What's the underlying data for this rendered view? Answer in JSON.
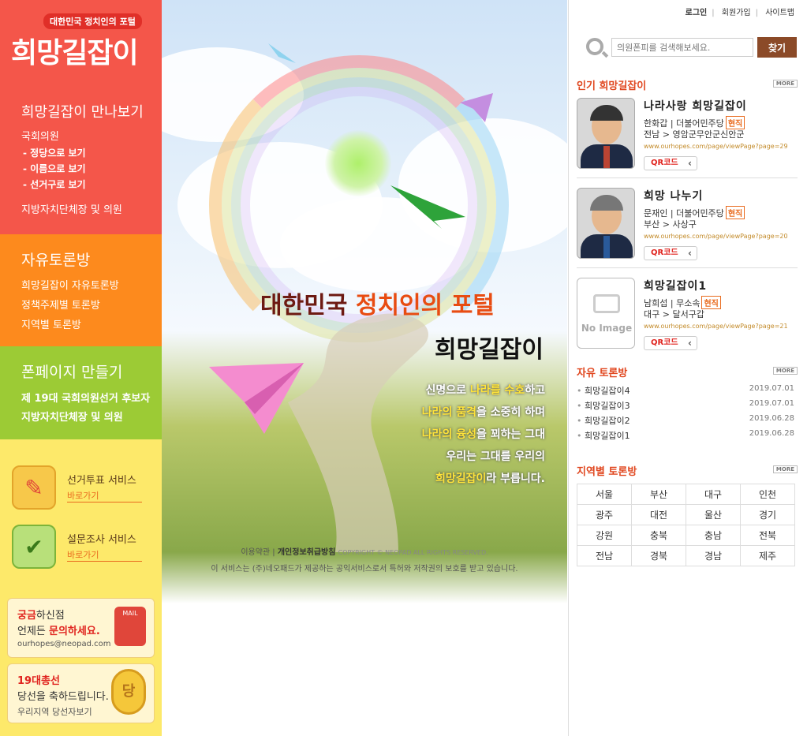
{
  "logo": {
    "tagline": "대한민국 정치인의 포털",
    "title": "희망길잡이"
  },
  "left": {
    "meet_title": "희망길잡이 만나보기",
    "national": "국회의원",
    "sub_items": [
      "-  정당으로 보기",
      "-  이름으로 보기",
      "-  선거구로 보기"
    ],
    "local": "지방자치단체장 및 의원",
    "forum_title": "자유토론방",
    "forum_items": [
      "희망길잡이 자유토론방",
      "정책주제별 토론방",
      "지역별 토론방"
    ],
    "fan_title": "폰페이지 만들기",
    "fan_items": [
      "제 19대 국회의원선거 후보자",
      "지방자치단체장 및 의원"
    ],
    "services": [
      {
        "title": "선거투표 서비스",
        "go": "바로가기",
        "icon": "vote-icon"
      },
      {
        "title": "설문조사 서비스",
        "go": "바로가기",
        "icon": "survey-icon"
      }
    ],
    "promo1": {
      "line1_red": "궁금",
      "line1": "하신점",
      "line2": "언제든 ",
      "line2_red": "문의하세요.",
      "email": "ourhopes@neopad.com",
      "icon_label": "MAIL"
    },
    "promo2": {
      "line1": "19대총선",
      "line2": "당선을 축하드립니다.",
      "line3": "우리지역 당선자보기",
      "medal": "당"
    }
  },
  "center": {
    "slogan_a": "대한민국 ",
    "slogan_b": "정치인의 포털",
    "slogan_2": "희망길잡이",
    "poem": [
      {
        "pre": "신명으로 ",
        "hl": "나라를 수호",
        "post": "하고"
      },
      {
        "pre": "",
        "hl": "나라의 품격",
        "post": "을 소중히 하며"
      },
      {
        "pre": "",
        "hl": "나라의 융성",
        "post": "을 꾀하는 그대"
      },
      {
        "pre": "우리는 그대를 우리의",
        "hl": "",
        "post": ""
      },
      {
        "pre": "",
        "hl": "희망길잡이",
        "post": "라 부릅니다."
      }
    ],
    "footer_terms": "이용약관",
    "footer_privacy": "개인정보취급방침",
    "footer_copy": "COPYRIGHT ©  NEOPAD ALL RIGHTS RESERVED.",
    "footer_note": "이 서비스는 (주)네오패드가 제공하는 공익서비스로서 특허와 저작권의 보호를 받고 있습니다."
  },
  "right": {
    "nav": [
      "로그인",
      "회원가입",
      "사이트맵"
    ],
    "search": {
      "placeholder": "의원폰피를 검색해보세요.",
      "button": "찾기"
    },
    "popular_title": "인기 희망길잡이",
    "more": "MORE",
    "cards": [
      {
        "name": "나라사랑 희망길잡이",
        "person": "한화갑",
        "party": "더불어민주당",
        "badge": "현직",
        "region": "전남 > 영암군무안군신안군",
        "url": "www.ourhopes.com/page/viewPage?page=29",
        "qr": "QR코드"
      },
      {
        "name": "희망 나누기",
        "person": "문재인",
        "party": "더불어민주당",
        "badge": "현직",
        "region": "부산 > 사상구",
        "url": "www.ourhopes.com/page/viewPage?page=20",
        "qr": "QR코드"
      },
      {
        "name": "희망길잡이1",
        "person": "남희섭",
        "party": "무소속",
        "badge": "현직",
        "region": "대구 > 달서구갑",
        "url": "www.ourhopes.com/page/viewPage?page=21",
        "qr": "QR코드",
        "noimage": "No Image"
      }
    ],
    "forum_title": "자유 토론방",
    "forum": [
      {
        "title": "희망길잡이4",
        "date": "2019.07.01"
      },
      {
        "title": "희망길잡이3",
        "date": "2019.07.01"
      },
      {
        "title": "희망길잡이2",
        "date": "2019.06.28"
      },
      {
        "title": "희망길잡이1",
        "date": "2019.06.28"
      }
    ],
    "region_title": "지역별 토론방",
    "regions": [
      [
        "서울",
        "부산",
        "대구",
        "인천"
      ],
      [
        "광주",
        "대전",
        "울산",
        "경기"
      ],
      [
        "강원",
        "충북",
        "충남",
        "전북"
      ],
      [
        "전남",
        "경북",
        "경남",
        "제주"
      ]
    ]
  }
}
